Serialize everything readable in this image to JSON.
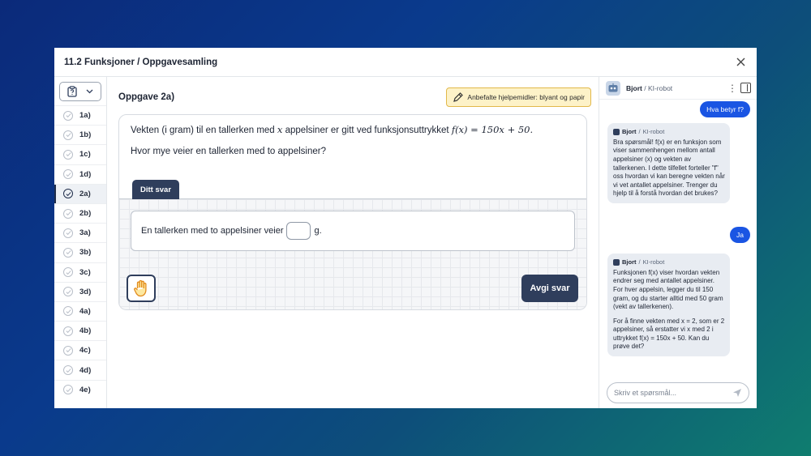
{
  "window": {
    "title": "11.2 Funksjoner / Oppgavesamling"
  },
  "sidebar": {
    "items": [
      {
        "label": "1a)"
      },
      {
        "label": "1b)"
      },
      {
        "label": "1c)"
      },
      {
        "label": "1d)"
      },
      {
        "label": "2a)",
        "active": true
      },
      {
        "label": "2b)"
      },
      {
        "label": "3a)"
      },
      {
        "label": "3b)"
      },
      {
        "label": "3c)"
      },
      {
        "label": "3d)"
      },
      {
        "label": "4a)"
      },
      {
        "label": "4b)"
      },
      {
        "label": "4c)"
      },
      {
        "label": "4d)"
      },
      {
        "label": "4e)"
      }
    ]
  },
  "main": {
    "task_title": "Oppgave 2a)",
    "tools_badge": "Anbefalte hjelpemidler: blyant og papir",
    "question": {
      "line1_text": "Vekten (i gram) til en tallerken med",
      "line1_var": "x",
      "line1_text2": "appelsiner er gitt ved funksjonsuttrykket",
      "line1_formula": "f(x) = 150x + 50.",
      "line2": "Hvor mye veier en tallerken med to appelsiner?"
    },
    "answer_tab": "Ditt svar",
    "answer_prefix": "En tallerken med to appelsiner veier",
    "answer_value": "",
    "answer_suffix": "g.",
    "submit_label": "Avgi svar"
  },
  "chat": {
    "bot_name": "Bjort",
    "bot_role": "KI-robot",
    "messages": [
      {
        "from": "user",
        "text": "Hva betyr f?"
      },
      {
        "from": "bot",
        "name": "Bjort",
        "role": "KI-robot",
        "paragraphs": [
          "Bra spørsmål! f(x) er en funksjon som viser sammenhengen mellom antall appelsiner (x) og vekten av tallerkenen. I dette tilfellet forteller \"f\" oss hvordan vi kan beregne vekten når vi vet antallet appelsiner. Trenger du hjelp til å forstå hvordan det brukes?"
        ]
      },
      {
        "from": "user",
        "text": "Ja"
      },
      {
        "from": "bot",
        "name": "Bjort",
        "role": "KI-robot",
        "paragraphs": [
          "Funksjonen f(x) viser hvordan vekten endrer seg med antallet appelsiner. For hver appelsin, legger du til 150 gram, og du starter alltid med 50 gram (vekt av tallerkenen).",
          "For å finne vekten med x = 2, som er 2 appelsiner, så erstatter vi x med 2 i uttrykket f(x) = 150x + 50. Kan du prøve det?"
        ]
      }
    ],
    "input_placeholder": "Skriv et spørsmål..."
  }
}
